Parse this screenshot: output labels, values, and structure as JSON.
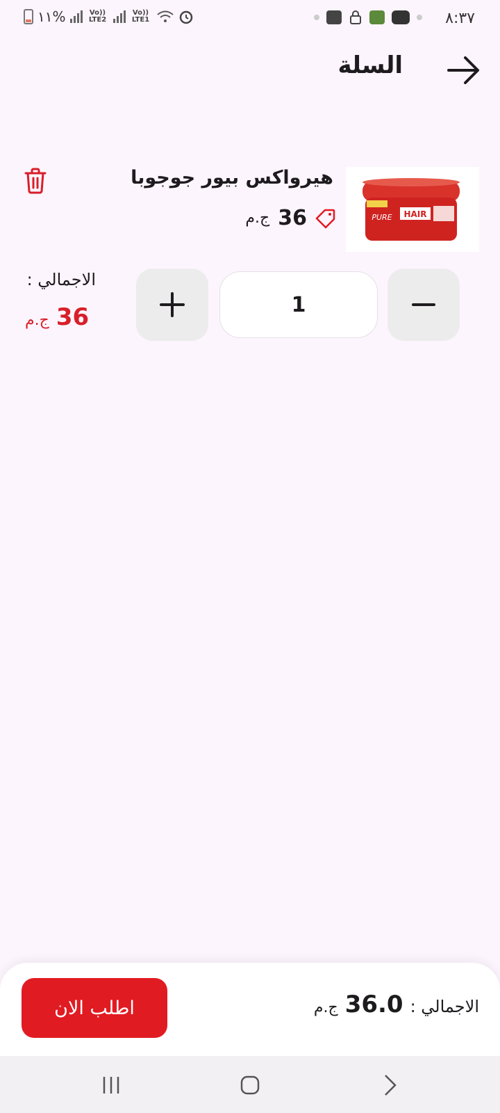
{
  "status_bar": {
    "time": "٨:٣٧",
    "battery": "١١%",
    "sim1": "Vo)) LTE2",
    "sim2": "Vo)) LTE1"
  },
  "header": {
    "title": "السلة"
  },
  "cart": {
    "item": {
      "name": "هيرواكس بيور جوجوبا",
      "price": "36",
      "currency": "ج.م",
      "image_label": "HAIR PURE"
    },
    "quantity": "1",
    "line_total_label": "الاجمالي :",
    "line_total_value": "36",
    "line_total_currency": "ج.م"
  },
  "checkout": {
    "total_label": "الاجمالي :",
    "total_value": "36.0",
    "total_currency": "ج.م",
    "order_button": "اطلب الان"
  },
  "colors": {
    "accent": "#e11b22",
    "background": "#fdf5fd"
  },
  "icons": [
    "arrow-right-icon",
    "trash-icon",
    "price-tag-icon",
    "plus-icon",
    "minus-icon",
    "recents-icon",
    "home-icon",
    "back-chevron-icon"
  ]
}
